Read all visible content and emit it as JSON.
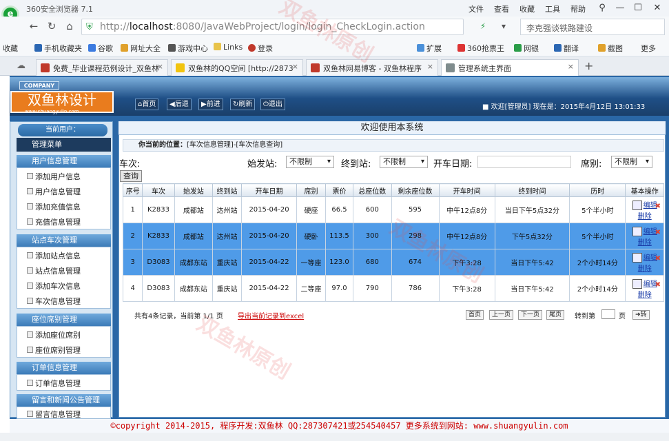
{
  "browser": {
    "app_title": "360安全浏览器 7.1",
    "menu": [
      "文件",
      "查看",
      "收藏",
      "工具",
      "帮助"
    ],
    "url_host": "localhost",
    "url_rest": ":8080/JavaWebProject/login/login_CheckLogin.action",
    "url_prefix": "http://",
    "search_text": "李克强谈铁路建设",
    "bookmarks": [
      "收藏",
      "手机收藏夹",
      "谷歌",
      "网址大全",
      "游戏中心",
      "Links",
      "登录",
      "扩展",
      "360抢票王",
      "网银",
      "翻译",
      "截图",
      "更多"
    ],
    "tabs": [
      {
        "label": "免费_毕业课程范例设计_双鱼林"
      },
      {
        "label": "双鱼林的QQ空间 [http://2873"
      },
      {
        "label": "双鱼林网易博客 - 双鱼林程序"
      },
      {
        "label": "管理系统主界面"
      }
    ]
  },
  "header": {
    "company": "COMPANY",
    "brand": "双鱼林设计",
    "brand_url": "www.shuangyulin.com",
    "buttons": [
      "首页",
      "后退",
      "前进",
      "刷新",
      "退出"
    ],
    "info": "欢迎[管理员]  现在是：2015年4月12日 13:01:33"
  },
  "sidebar": {
    "current_user": "当前用户：",
    "menu_title": "管理菜单",
    "sections": [
      {
        "title": "用户信息管理",
        "items": [
          "添加用户信息",
          "用户信息管理",
          "添加充值信息",
          "充值信息管理"
        ]
      },
      {
        "title": "站点车次管理",
        "items": [
          "添加站点信息",
          "站点信息管理",
          "添加车次信息",
          "车次信息管理"
        ]
      },
      {
        "title": "座位席别管理",
        "items": [
          "添加座位席别",
          "座位席别管理"
        ]
      },
      {
        "title": "订单信息管理",
        "items": [
          "订单信息管理"
        ]
      },
      {
        "title": "留言和新闻公告管理",
        "items": [
          "留言信息管理"
        ]
      }
    ]
  },
  "main": {
    "welcome": "欢迎使用本系统",
    "position_label": "你当前的位置：",
    "position": "[车次信息管理]-[车次信息查询]",
    "filter": {
      "train_label": "车次:",
      "start_label": "始发站:",
      "start_value": "不限制",
      "end_label": "终到站:",
      "end_value": "不限制",
      "date_label": "开车日期:",
      "seat_label": "席别:",
      "seat_value": "不限制",
      "query_button": "查询"
    },
    "columns": [
      "序号",
      "车次",
      "始发站",
      "终到站",
      "开车日期",
      "席别",
      "票价",
      "总座位数",
      "剩余座位数",
      "开车时间",
      "终到时间",
      "历时",
      "基本操作"
    ],
    "rows": [
      [
        "1",
        "K2833",
        "成都站",
        "达州站",
        "2015-04-20",
        "硬座",
        "66.5",
        "600",
        "595",
        "中午12点8分",
        "当日下午5点32分",
        "5个半小时"
      ],
      [
        "2",
        "K2833",
        "成都站",
        "达州站",
        "2015-04-20",
        "硬卧",
        "113.5",
        "300",
        "298",
        "中午12点8分",
        "下午5点32分",
        "5个半小时"
      ],
      [
        "3",
        "D3083",
        "成都东站",
        "重庆站",
        "2015-04-22",
        "一等座",
        "123.0",
        "680",
        "674",
        "下午3:28",
        "当日下午5:42",
        "2个小时14分"
      ],
      [
        "4",
        "D3083",
        "成都东站",
        "重庆站",
        "2015-04-22",
        "二等座",
        "97.0",
        "790",
        "786",
        "下午3:28",
        "当日下午5:42",
        "2个小时14分"
      ]
    ],
    "op_edit": "编辑",
    "op_delete": "删除",
    "pager": {
      "summary": "共有4条记录，当前第 1/1 页",
      "export": "导出当前记录到excel",
      "first": "首页",
      "prev": "上一页",
      "next": "下一页",
      "last": "尾页",
      "goto": "转到第",
      "page": "页",
      "go": "转"
    }
  },
  "footer": {
    "text": "©copyright 2014-2015, 程序开发:双鱼林  QQ:287307421或254540457  更多系统到网站: www.shuangyulin.com"
  },
  "colors": {
    "header_blue": "#1f4f86",
    "row_selected": "#4f9be8",
    "brand_orange": "#e97c1e"
  }
}
